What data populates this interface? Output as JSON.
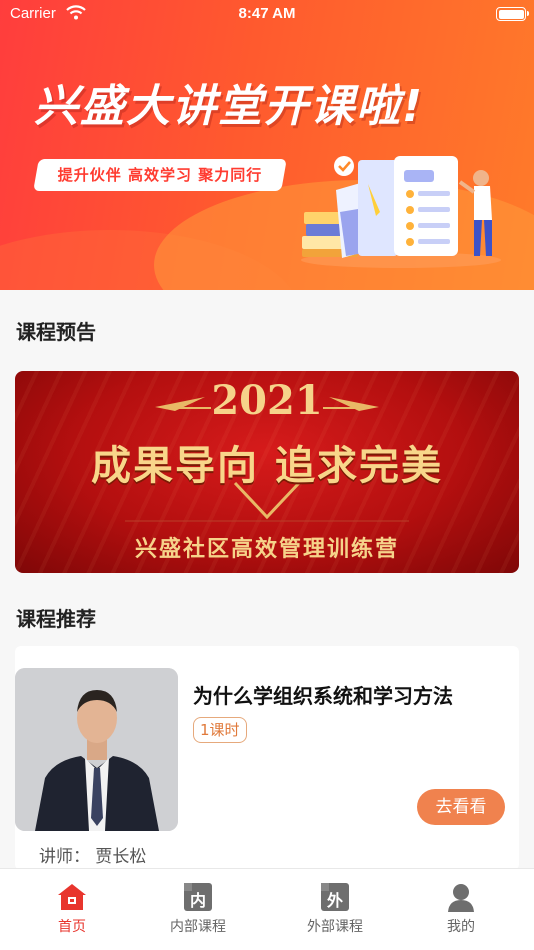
{
  "status_bar": {
    "carrier": "Carrier",
    "time": "8:47 AM"
  },
  "hero": {
    "title": "兴盛大讲堂开课啦!",
    "slogan": "提升伙伴  高效学习  聚力同行"
  },
  "sections": {
    "preview_title": "课程预告",
    "recommend_title": "课程推荐"
  },
  "preview_banner": {
    "year": "2021",
    "motto": "成果导向  追求完美",
    "camp": "兴盛社区高效管理训练营"
  },
  "course": {
    "title": "为什么学组织系统和学习方法",
    "hours": "1课时",
    "watch_label": "去看看",
    "teacher": "讲师：  贾长松"
  },
  "tabs": [
    {
      "label": "首页",
      "icon": "home-icon",
      "glyph": ""
    },
    {
      "label": "内部课程",
      "icon": "internal-course-icon",
      "glyph": "内"
    },
    {
      "label": "外部课程",
      "icon": "external-course-icon",
      "glyph": "外"
    },
    {
      "label": "我的",
      "icon": "profile-icon",
      "glyph": ""
    }
  ],
  "colors": {
    "accent": "#e8352d",
    "button": "#f0824e",
    "hero_start": "#ff3d3d",
    "hero_end": "#ff7b2a"
  }
}
